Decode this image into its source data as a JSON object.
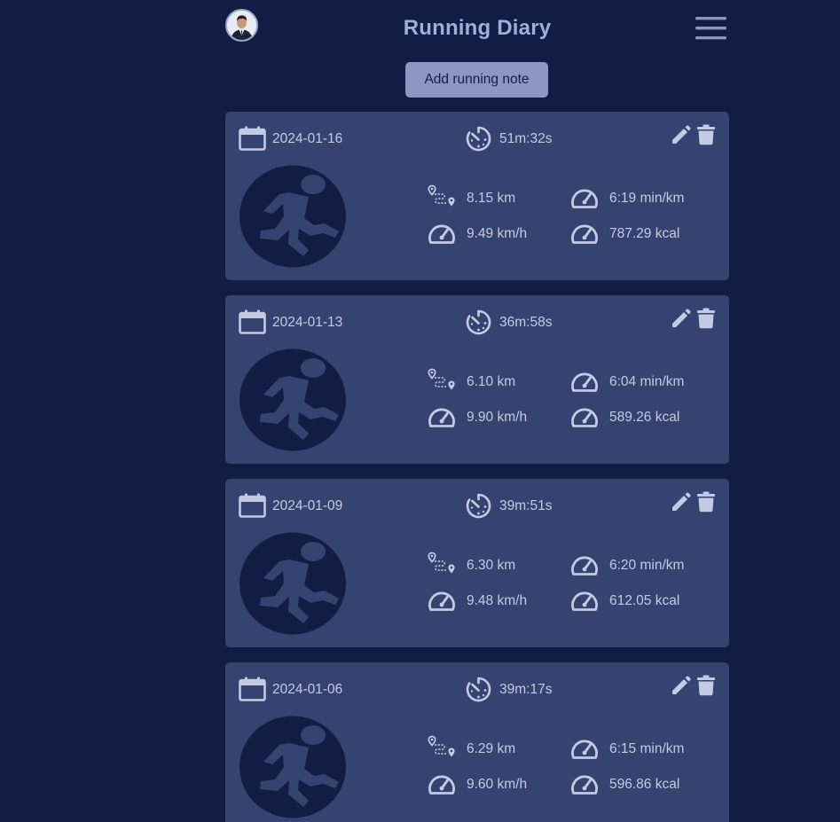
{
  "header": {
    "title": "Running Diary",
    "add_button_label": "Add running note"
  },
  "colors": {
    "background": "#111d42",
    "card": "#354371",
    "text": "#c3cbe2",
    "title": "#9dafd6",
    "button": "#8c98c0"
  },
  "runs": [
    {
      "date": "2024-01-16",
      "duration": "51m:32s",
      "distance": "8.15 km",
      "pace": "6:19 min/km",
      "speed": "9.49 km/h",
      "calories": "787.29 kcal"
    },
    {
      "date": "2024-01-13",
      "duration": "36m:58s",
      "distance": "6.10 km",
      "pace": "6:04 min/km",
      "speed": "9.90 km/h",
      "calories": "589.26 kcal"
    },
    {
      "date": "2024-01-09",
      "duration": "39m:51s",
      "distance": "6.30 km",
      "pace": "6:20 min/km",
      "speed": "9.48 km/h",
      "calories": "612.05 kcal"
    },
    {
      "date": "2024-01-06",
      "duration": "39m:17s",
      "distance": "6.29 km",
      "pace": "6:15 min/km",
      "speed": "9.60 km/h",
      "calories": "596.86 kcal"
    }
  ],
  "icons": {
    "avatar": "profile-photo",
    "menu": "hamburger-menu-icon",
    "date": "calendar-icon",
    "duration": "stopwatch-icon",
    "distance": "route-icon",
    "pace": "speedometer-icon",
    "speed": "speedometer-icon",
    "calories": "speedometer-icon",
    "edit": "pencil-icon",
    "delete": "trash-icon",
    "activity": "runner-icon"
  }
}
